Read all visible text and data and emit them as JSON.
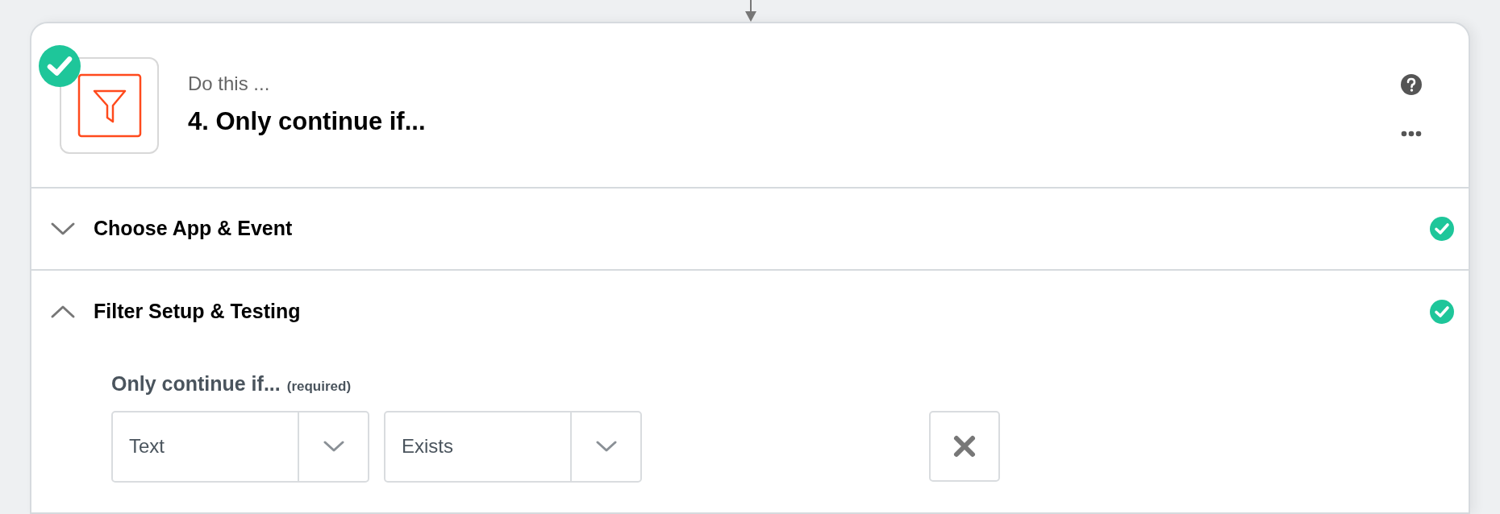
{
  "step": {
    "completed": true,
    "subtitle": "Do this ...",
    "title": "4. Only continue if..."
  },
  "sections": [
    {
      "title": "Choose App & Event",
      "expanded": false,
      "completed": true
    },
    {
      "title": "Filter Setup & Testing",
      "expanded": true,
      "completed": true
    }
  ],
  "filter": {
    "label": "Only continue if...",
    "hint": "(required)",
    "conditions": [
      {
        "field": "Text",
        "operator": "Exists"
      }
    ]
  }
}
